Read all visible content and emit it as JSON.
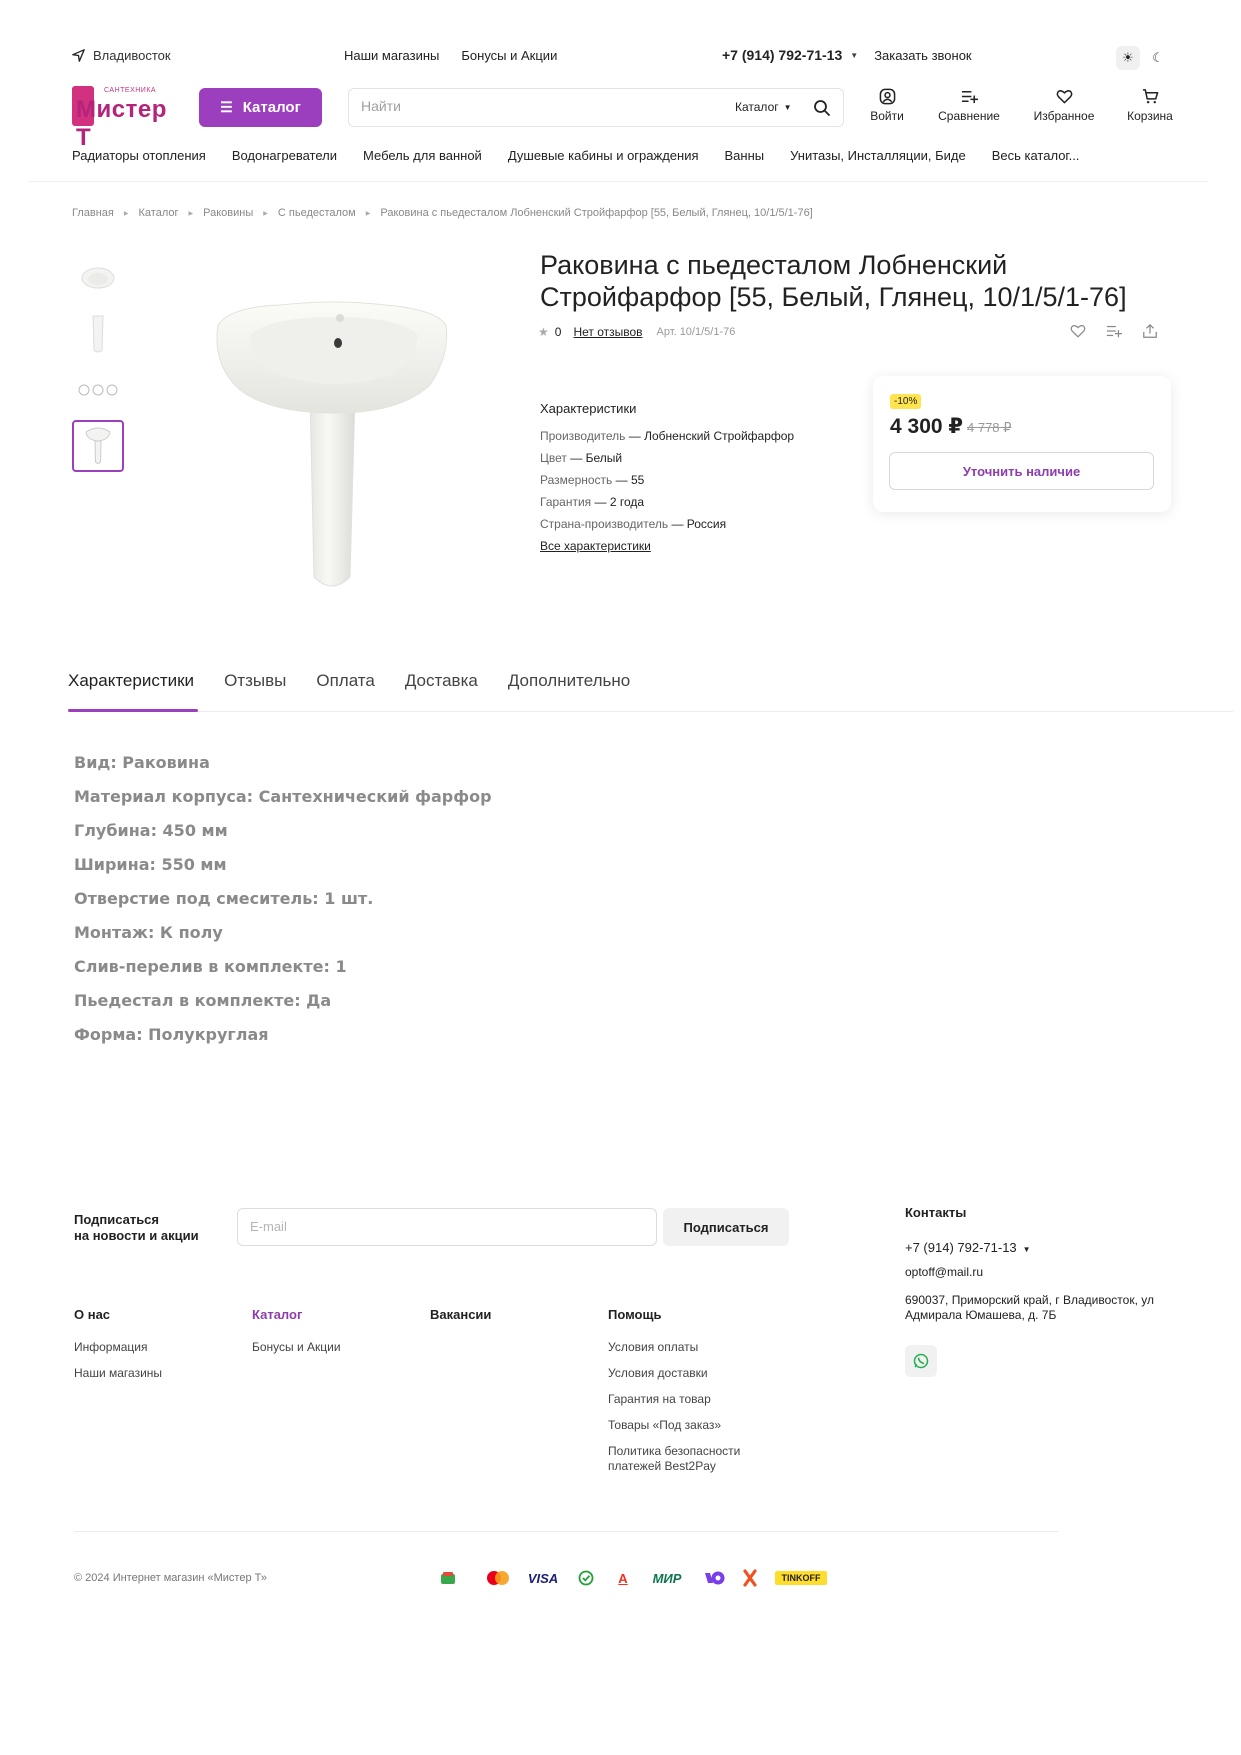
{
  "top": {
    "city": "Владивосток",
    "links": [
      "Наши магазины",
      "Бонусы и Акции"
    ],
    "phone": "+7 (914) 792-71-13",
    "callback": "Заказать звонок"
  },
  "logo": {
    "small_text": "САНТЕХНИКА",
    "brand_text": "Мистер Т"
  },
  "header": {
    "catalog_button": "Каталог",
    "search_placeholder": "Найти",
    "search_scope": "Каталог",
    "icons": [
      {
        "label": "Войти",
        "icon": "user-icon"
      },
      {
        "label": "Сравнение",
        "icon": "compare-icon"
      },
      {
        "label": "Избранное",
        "icon": "heart-icon"
      },
      {
        "label": "Корзина",
        "icon": "cart-icon"
      }
    ]
  },
  "nav": [
    "Радиаторы отопления",
    "Водонагреватели",
    "Мебель для ванной",
    "Душевые кабины и ограждения",
    "Ванны",
    "Унитазы, Инсталляции, Биде",
    "Весь каталог..."
  ],
  "breadcrumbs": [
    "Главная",
    "Каталог",
    "Раковины",
    "С пьедесталом",
    "Раковина с пьедесталом Лобненский Стройфарфор [55, Белый, Глянец, 10/1/5/1-76]"
  ],
  "product": {
    "title_line1": "Раковина с пьедесталом Лобненский",
    "title_line2": "Стройфарфор [55, Белый, Глянец, 10/1/5/1-76]",
    "rating": "0",
    "reviews": "Нет отзывов",
    "article": "Арт. 10/1/5/1-76"
  },
  "specs": {
    "heading": "Характеристики",
    "items": [
      {
        "key": "Производитель",
        "value": "Лобненский Стройфарфор"
      },
      {
        "key": "Цвет",
        "value": "Белый"
      },
      {
        "key": "Размерность",
        "value": "55"
      },
      {
        "key": "Гарантия",
        "value": "2 года"
      },
      {
        "key": "Страна-производитель",
        "value": "Россия"
      }
    ],
    "all_link": "Все характеристики"
  },
  "price": {
    "discount": "-10%",
    "current": "4 300 ₽",
    "old": "4 778 ₽",
    "button": "Уточнить наличие"
  },
  "tabs": [
    "Характеристики",
    "Отзывы",
    "Оплата",
    "Доставка",
    "Дополнительно"
  ],
  "description": [
    "Вид: Раковина",
    "Материал корпуса: Сантехнический фарфор",
    "Глубина: 450 мм",
    "Ширина: 550 мм",
    "Отверстие под смеситель: 1 шт.",
    "Монтаж: К полу",
    "Слив-перелив в комплекте: 1",
    "Пьедестал в комплекте: Да",
    "Форма: Полукруглая"
  ],
  "footer": {
    "subscribe_label_1": "Подписаться",
    "subscribe_label_2": "на новости и акции",
    "email_placeholder": "E-mail",
    "subscribe_button": "Подписаться",
    "columns": [
      {
        "title": "О нас",
        "items": [
          "Информация",
          "Наши магазины"
        ]
      },
      {
        "title": "Каталог",
        "items": [
          "Бонусы и Акции"
        ]
      },
      {
        "title": "Вакансии",
        "items": []
      },
      {
        "title": "Помощь",
        "items": [
          "Условия оплаты",
          "Условия доставки",
          "Гарантия на товар",
          "Товары «Под заказ»",
          "Политика безопасности платежей Best2Pay"
        ]
      }
    ],
    "contacts": {
      "title": "Контакты",
      "phone": "+7 (914) 792-71-13",
      "email": "optoff@mail.ru",
      "address": "690037, Приморский край, г Владивосток, ул Адмирала Юмашева, д. 7Б"
    },
    "copyright": "© 2024 Интернет магазин «Мистер Т»",
    "payments": {
      "visa": "VISA",
      "mir": "МИР",
      "tinkoff": "TINKOFF",
      "alfa": "А"
    }
  },
  "colors": {
    "accent": "#9b3fbf",
    "brand_pink": "#d1317e",
    "discount_badge": "#ffe34f"
  }
}
